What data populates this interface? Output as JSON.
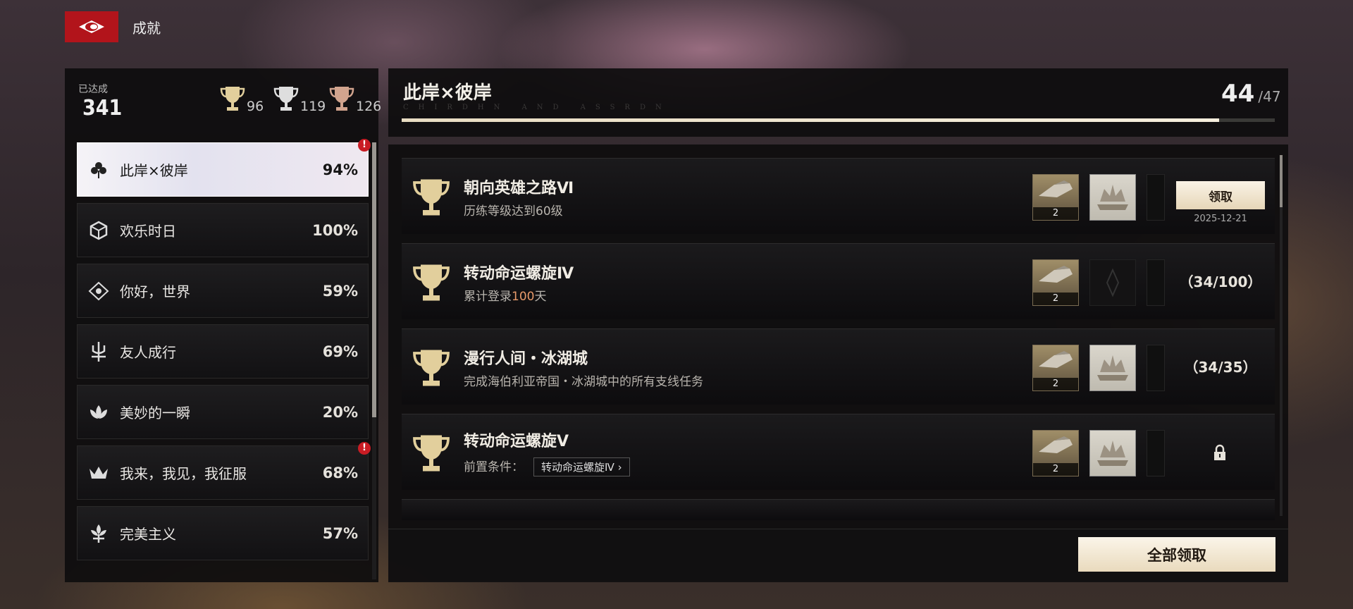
{
  "header": {
    "title": "成就"
  },
  "summary": {
    "achieved_label": "已达成",
    "achieved_count": "341",
    "trophies": [
      {
        "tier": "gold",
        "count": "96",
        "color": "#e2cf9c"
      },
      {
        "tier": "silver",
        "count": "119",
        "color": "#dedede"
      },
      {
        "tier": "bronze",
        "count": "126",
        "color": "#d2a48e"
      }
    ]
  },
  "categories": [
    {
      "name": "此岸×彼岸",
      "pct": "94%",
      "icon": "clover-icon",
      "active": true,
      "alert": "!"
    },
    {
      "name": "欢乐时日",
      "pct": "100%",
      "icon": "cube-icon"
    },
    {
      "name": "你好，世界",
      "pct": "59%",
      "icon": "diamond-eye-icon"
    },
    {
      "name": "友人成行",
      "pct": "69%",
      "icon": "trident-icon"
    },
    {
      "name": "美妙的一瞬",
      "pct": "20%",
      "icon": "lotus-icon"
    },
    {
      "name": "我来，我见，我征服",
      "pct": "68%",
      "icon": "crown-icon",
      "alert": "!"
    },
    {
      "name": "完美主义",
      "pct": "57%",
      "icon": "fleur-icon"
    }
  ],
  "section": {
    "title": "此岸×彼岸",
    "subtitle": "CHIRDHN AND ASSRDN",
    "progress_current": "44",
    "progress_total": "/47",
    "progress_fraction": 0.936
  },
  "achievements": [
    {
      "name": "朝向英雄之路Ⅵ",
      "desc": "历练等级达到60级",
      "reward_qty": "2",
      "claim_label": "领取",
      "claim_date": "2025-12-21"
    },
    {
      "name": "转动命运螺旋Ⅳ",
      "desc_pre": "累计登录",
      "desc_hl": "100",
      "desc_post": "天",
      "reward_qty": "2",
      "count": "（34/100）"
    },
    {
      "name": "漫行人间・冰湖城",
      "desc": "完成海伯利亚帝国・冰湖城中的所有支线任务",
      "reward_qty": "2",
      "count": "（34/35）"
    },
    {
      "name": "转动命运螺旋Ⅴ",
      "prereq_label": "前置条件：",
      "prereq_link": "转动命运螺旋Ⅳ",
      "reward_qty": "2"
    }
  ],
  "footer": {
    "claim_all": "全部领取"
  }
}
